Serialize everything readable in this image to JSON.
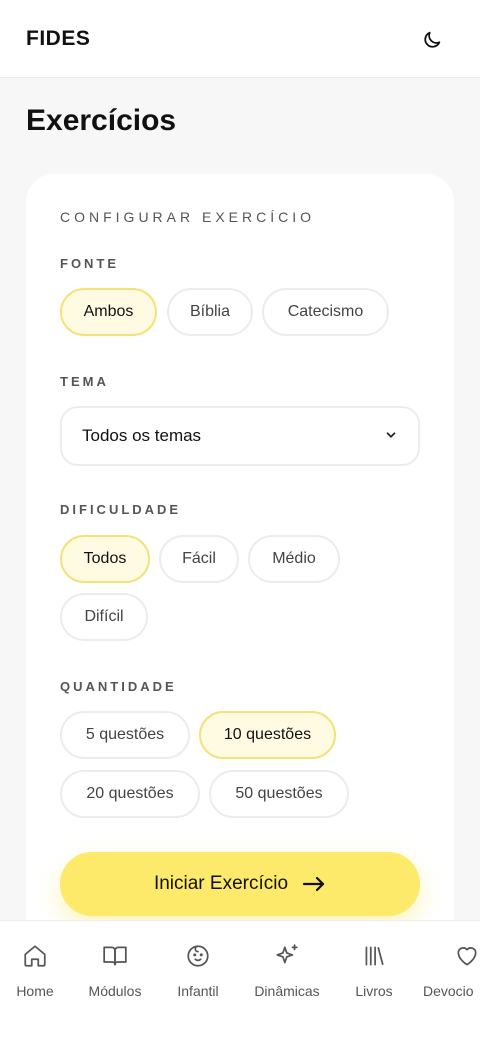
{
  "app": {
    "logo": "FIDES"
  },
  "header": {
    "theme_toggle_icon": "moon-icon"
  },
  "page": {
    "title": "Exercícios"
  },
  "config": {
    "heading": "CONFIGURAR EXERCÍCIO",
    "fonte": {
      "label": "FONTE",
      "options": [
        "Ambos",
        "Bíblia",
        "Catecismo"
      ],
      "selected": "Ambos"
    },
    "tema": {
      "label": "TEMA",
      "value": "Todos os temas",
      "icon": "chevron-down-icon"
    },
    "dificuldade": {
      "label": "DIFICULDADE",
      "options": [
        "Todos",
        "Fácil",
        "Médio",
        "Difícil"
      ],
      "selected": "Todos"
    },
    "quantidade": {
      "label": "QUANTIDADE",
      "options": [
        "5 questões",
        "10 questões",
        "20 questões",
        "50 questões"
      ],
      "selected": "10 questões"
    },
    "start_button": {
      "label": "Iniciar Exercício",
      "icon": "arrow-right-icon"
    }
  },
  "nav": {
    "items": [
      {
        "label": "Home",
        "icon": "home-icon"
      },
      {
        "label": "Módulos",
        "icon": "book-open-icon"
      },
      {
        "label": "Infantil",
        "icon": "baby-face-icon"
      },
      {
        "label": "Dinâmicas",
        "icon": "sparkles-icon"
      },
      {
        "label": "Livros",
        "icon": "library-icon"
      },
      {
        "label": "Devocio",
        "icon": "heart-icon"
      }
    ]
  },
  "colors": {
    "accent": "#fde96a",
    "chip_active_border": "#f3e27a",
    "chip_active_bg": "#fffbe3",
    "background": "#f7f7f7"
  }
}
